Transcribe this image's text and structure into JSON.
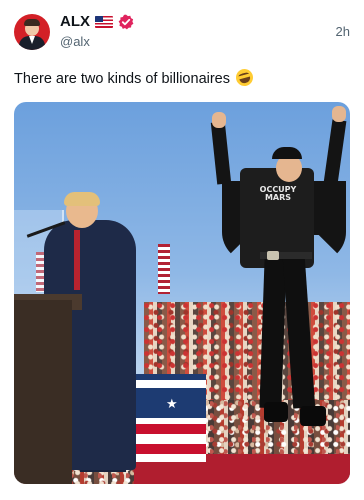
{
  "header": {
    "display_name": "ALX",
    "handle": "@alx",
    "timestamp": "2h",
    "flag_icon": "us-flag-icon",
    "badge_icon": "verified-badge-icon",
    "badge_color": "#e0245e"
  },
  "tweet": {
    "text": "There are two kinds of billionaires",
    "emoji_icon": "rolling-on-floor-laughing-emoji-icon"
  },
  "media": {
    "shirt_text": "OCCUPY MARS"
  },
  "colors": {
    "primary_text": "#0f1419",
    "secondary_text": "#536471",
    "accent": "#e0245e"
  }
}
